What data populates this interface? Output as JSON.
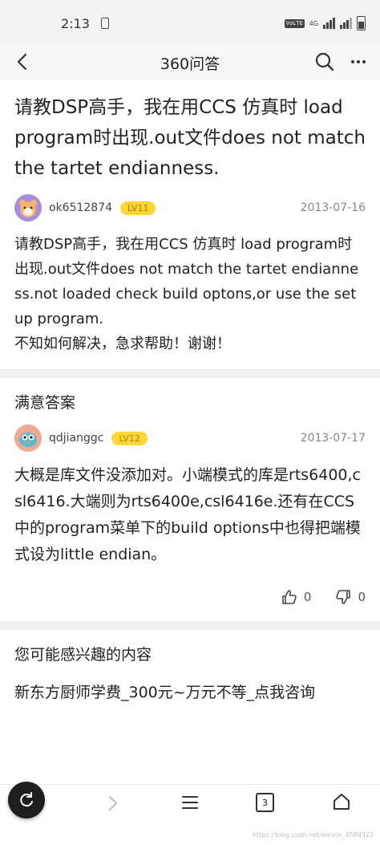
{
  "status": {
    "time": "2:13",
    "volte": "VoLTE",
    "network": "4G"
  },
  "nav": {
    "title": "360问答"
  },
  "question": {
    "title": "请教DSP高手，我在用CCS 仿真时 load program时出现.out文件does not match the tartet endianness.",
    "user": "ok6512874",
    "level": "LV11",
    "date": "2013-07-16",
    "body": "请教DSP高手，我在用CCS 仿真时 load program时出现.out文件does not match the tartet endianness.not loaded check build optons,or use the set up program.\n不知如何解决，急求帮助！谢谢！"
  },
  "answer": {
    "section_title": "满意答案",
    "user": "qdjianggc",
    "level": "LV12",
    "date": "2013-07-17",
    "body": "大概是库文件没添加对。小端模式的库是rts6400,csl6416.大端则为rts6400e,csl6416e.还有在CCS中的program菜单下的build options中也得把端模式设为little endian。",
    "likes": "0",
    "dislikes": "0"
  },
  "recommend": {
    "title": "您可能感兴趣的内容",
    "item": "新东方厨师学费_300元~万元不等_点我咨询"
  },
  "bottom_bar": {
    "tab_count": "3"
  },
  "watermark": "https://blog.csdn.net/weixin_4589322"
}
